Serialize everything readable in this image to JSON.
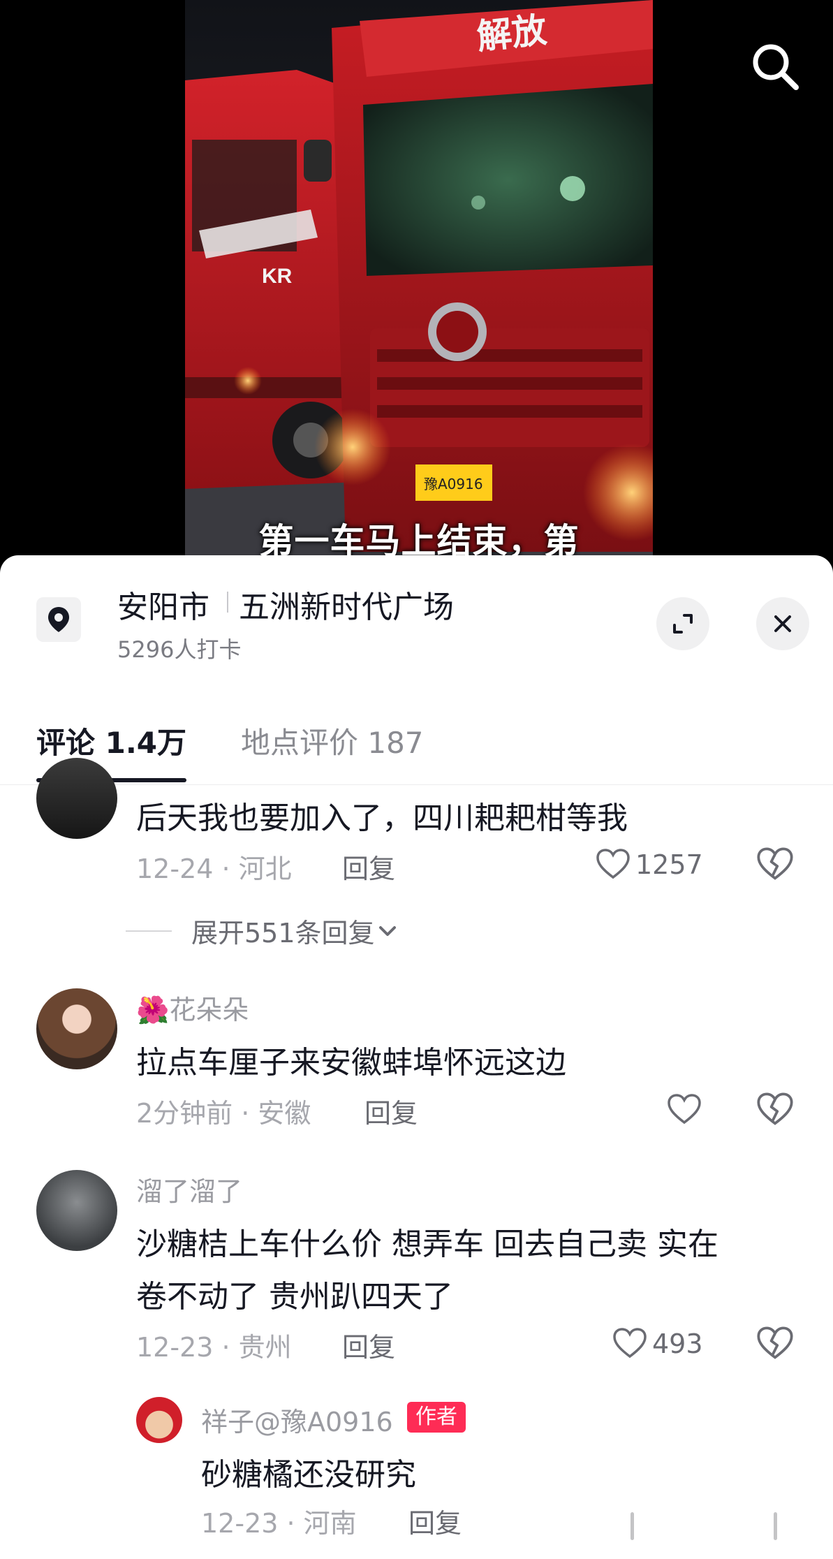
{
  "video": {
    "subtitle": "第一车马上结束，第",
    "plate_text": "豫 A0916"
  },
  "location": {
    "city": "安阳市",
    "place": "五洲新时代广场",
    "checkins": "5296人打卡"
  },
  "tabs": [
    {
      "label": "评论 1.4万"
    },
    {
      "label": "地点评价 187"
    }
  ],
  "comments": [
    {
      "text": "后天我也要加入了，四川耙耙柑等我",
      "meta": "12-24 · 河北",
      "reply_label": "回复",
      "likes": "1257",
      "expand": "展开551条回复"
    },
    {
      "name": "🌺花朵朵",
      "text": "拉点车厘子来安徽蚌埠怀远这边",
      "meta": "2分钟前 · 安徽",
      "reply_label": "回复"
    },
    {
      "name": "溜了溜了",
      "text_line1": "沙糖桔上车什么价  想弄车 回去自己卖 实在",
      "text_line2": "卷不动了 贵州趴四天了",
      "meta": "12-23 · 贵州",
      "reply_label": "回复",
      "likes": "493"
    }
  ],
  "reply": {
    "name": "祥子@豫A0916",
    "badge": "作者",
    "text": "砂糖橘还没研究",
    "meta": "12-23 · 河南",
    "reply_label": "回复"
  },
  "colors": {
    "accent": "#fe2c55",
    "truck_red": "#c8191f"
  }
}
